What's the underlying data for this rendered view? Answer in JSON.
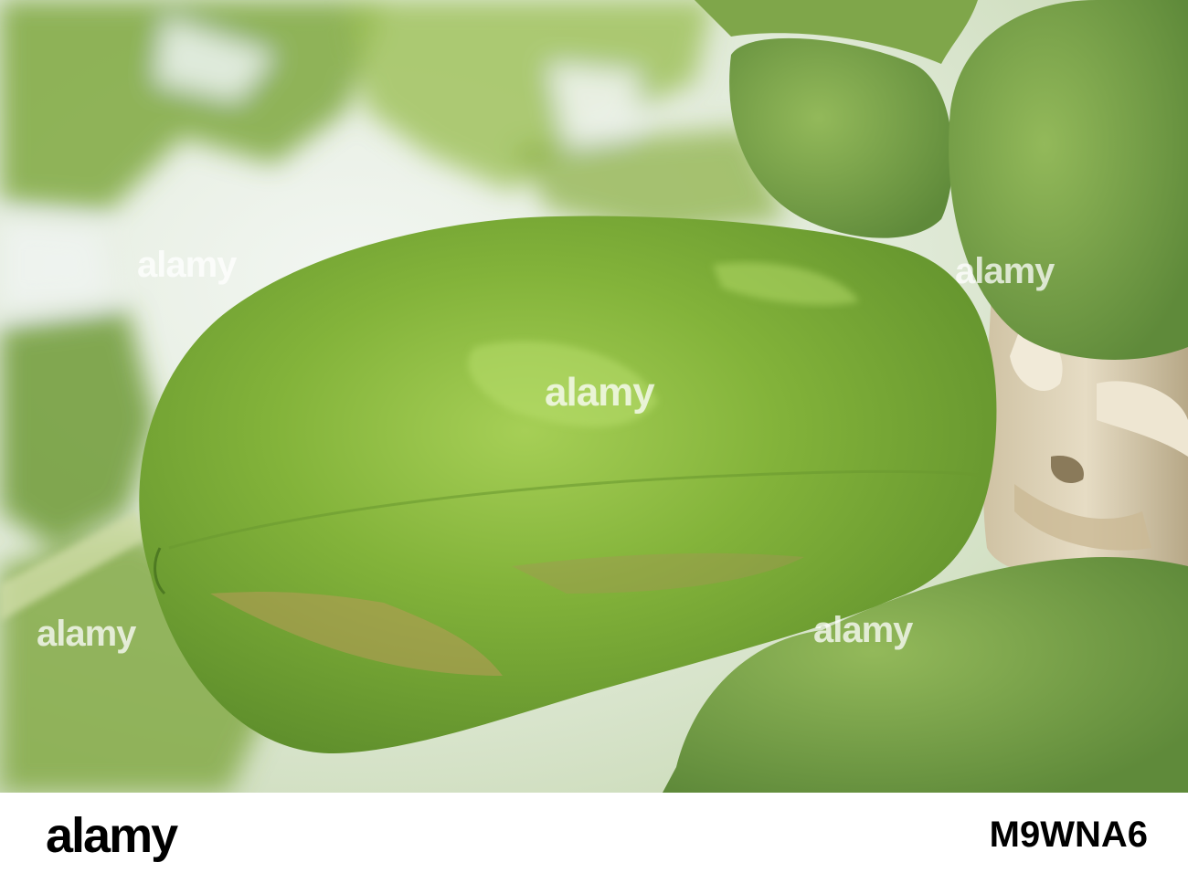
{
  "photo": {
    "subject_icon": "papaya-fruit",
    "colors": {
      "sky": "#e8f0f0",
      "leaf_dark": "#5e8a2a",
      "leaf_light": "#a9c96a",
      "fruit_main": "#7fae38",
      "fruit_highlight": "#a9d25a",
      "fruit_shadow": "#5b8a2a",
      "trunk": "#d9cdb2"
    }
  },
  "watermarks": {
    "center": "alamy",
    "left": "alamy",
    "right": "alamy",
    "bottom_left": "alamy",
    "bottom_right": "alamy"
  },
  "footer": {
    "logo": "alamy",
    "image_id": "M9WNA6"
  }
}
